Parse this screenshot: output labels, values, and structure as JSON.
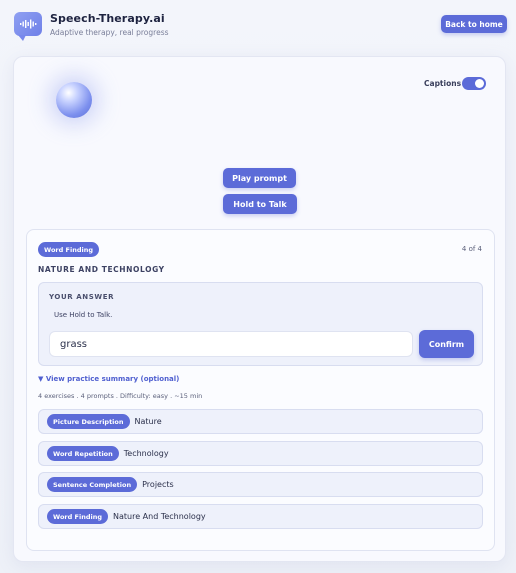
{
  "header": {
    "app_title": "Speech-Therapy.ai",
    "app_subtitle": "Adaptive therapy, real progress",
    "back_label": "Back to home"
  },
  "controls": {
    "captions_label": "Captions",
    "captions_on": true,
    "play_label": "Play prompt",
    "hold_label": "Hold to Talk"
  },
  "exercise": {
    "type": "Word Finding",
    "progress": "4 of 4",
    "title": "NATURE AND TECHNOLOGY",
    "answer_heading": "YOUR ANSWER",
    "answer_hint": "Use Hold to Talk.",
    "answer_value": "grass",
    "confirm_label": "Confirm"
  },
  "summary": {
    "toggle_label": "▼  View practice summary (optional)",
    "meta": "4 exercises  .  4 prompts  .  Difficulty: easy  .  ~15 min",
    "items": [
      {
        "type": "Picture Description",
        "topic": "Nature"
      },
      {
        "type": "Word Repetition",
        "topic": "Technology"
      },
      {
        "type": "Sentence Completion",
        "topic": "Projects"
      },
      {
        "type": "Word Finding",
        "topic": "Nature And Technology"
      }
    ]
  },
  "colors": {
    "accent": "#5c6bd8",
    "background": "#f3f5fb"
  }
}
